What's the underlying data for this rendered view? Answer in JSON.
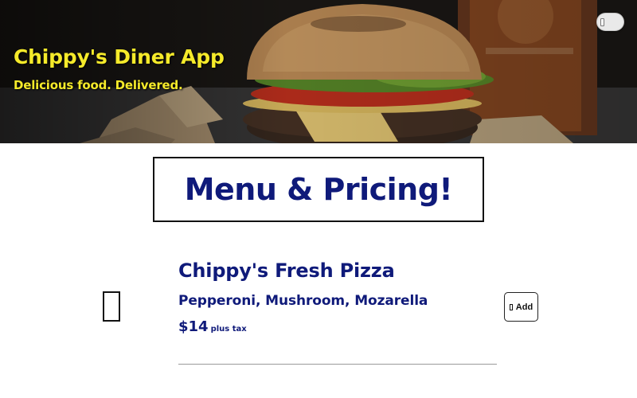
{
  "hero": {
    "title": "Chippy's Diner App",
    "tagline": "Delicious food. Delivered.",
    "image": "burger-photo",
    "title_color": "#f5ea2a"
  },
  "theme_toggle": {
    "icon": "toggle-switch"
  },
  "menu": {
    "heading": "Menu & Pricing!",
    "heading_color": "#0f1a7a"
  },
  "items": [
    {
      "name": "Chippy's Fresh Pizza",
      "description": "Pepperoni, Mushroom, Mozarella",
      "price": "$14",
      "price_note": "plus tax",
      "icon": "missing-glyph-icon",
      "add_label": "Add"
    }
  ]
}
